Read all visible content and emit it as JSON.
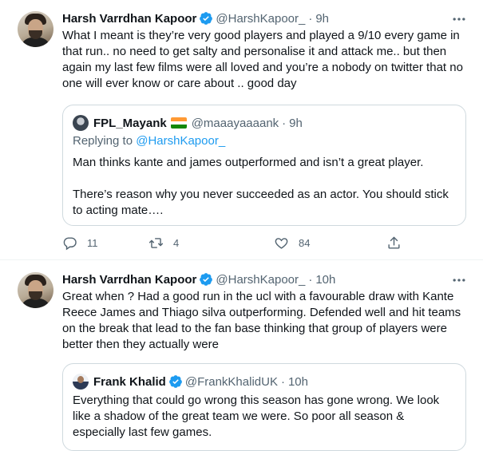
{
  "tweets": [
    {
      "author": {
        "name": "Harsh Varrdhan Kapoor",
        "handle": "@HarshKapoor_",
        "verified": true
      },
      "time": "9h",
      "text_lines": [
        "What I meant is they’re very good players and played a 9/10 every game in",
        "that run.. no need to get salty and personalise it and attack me.. but then",
        "again my last few films were all loved and you’re a nobody on twitter that no",
        "one will ever know or care about .. good day"
      ],
      "quote": {
        "author": {
          "name": "FPL_Mayank",
          "handle": "@maaayaaaank",
          "flag": "india-flag"
        },
        "time": "9h",
        "replying_to": {
          "prefix": "Replying to",
          "mention": "@HarshKapoor_"
        },
        "paragraphs": [
          [
            "Man thinks kante and james outperformed and isn’t a great player."
          ],
          [
            "There’s reason why you never succeeded as an actor. You should stick",
            "to acting mate…."
          ]
        ]
      },
      "actions": {
        "replies": "11",
        "retweets": "4",
        "likes": "84"
      }
    },
    {
      "author": {
        "name": "Harsh Varrdhan Kapoor",
        "handle": "@HarshKapoor_",
        "verified": true
      },
      "time": "10h",
      "text_lines": [
        "Great when ? Had a good run in the ucl with a favourable draw with Kante",
        "Reece James and Thiago silva outperforming. Defended well and hit teams",
        "on the break that lead to the fan base thinking that group of players were",
        "better then they actually were"
      ],
      "quote": {
        "author": {
          "name": "Frank Khalid",
          "handle": "@FrankKhalidUK",
          "verified": true
        },
        "time": "10h",
        "lines": [
          "Everything that could go wrong this season has gone wrong. We look",
          "like a shadow of the great team we were. So poor all season &",
          "especially last few games."
        ]
      }
    }
  ],
  "separator": "·",
  "colors": {
    "text": "#0f1419",
    "secondary": "#536471",
    "accent": "#1d9bf0",
    "border": "#cfd9de",
    "verified": "#1d9bf0"
  },
  "icons": [
    "verified-badge-icon",
    "more-icon",
    "reply-icon",
    "retweet-icon",
    "like-icon",
    "share-icon",
    "india-flag"
  ]
}
